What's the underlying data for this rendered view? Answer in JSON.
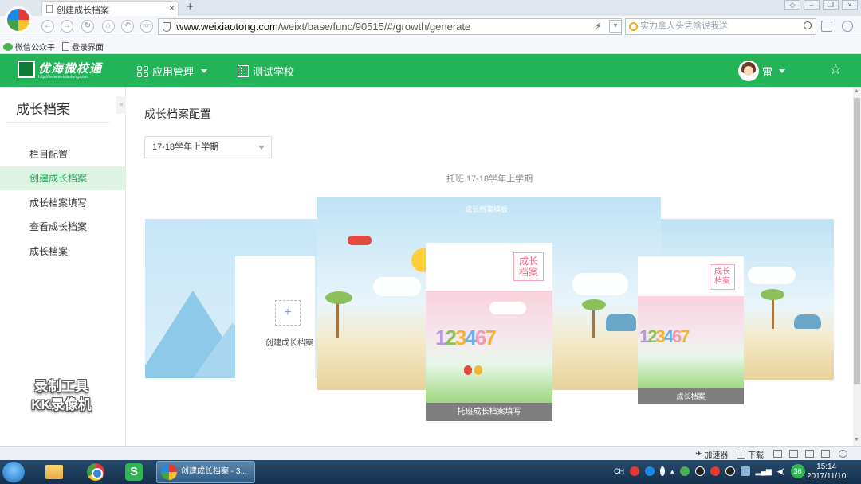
{
  "browser": {
    "tab_title": "创建成长档案",
    "url_domain": "www.weixiaotong.com",
    "url_path": "/weixt/base/func/90515/#/growth/generate",
    "search_placeholder": "实力拿人头凭啥说我送",
    "bookmarks": [
      "微信公众平",
      "登录界面"
    ],
    "new_tab": "+",
    "close": "×"
  },
  "header": {
    "logo_text": "优海微校通",
    "logo_sub": "http://www.weixiaotong.com",
    "menu_app": "应用管理",
    "menu_school": "测试学校",
    "user_name": "雷"
  },
  "sidebar": {
    "title": "成长档案",
    "collapse": "«",
    "items": [
      {
        "label": "栏目配置"
      },
      {
        "label": "创建成长档案"
      },
      {
        "label": "成长档案填写"
      },
      {
        "label": "查看成长档案"
      },
      {
        "label": "成长档案"
      }
    ],
    "active_index": 1,
    "watermark_line1": "录制工具",
    "watermark_line2": "KK录像机"
  },
  "main": {
    "page_title": "成长档案配置",
    "term_select": "17-18学年上学期",
    "section_label": "托班 17-18学年上学期",
    "create_label": "创建成长档案",
    "plus": "+",
    "banner_text": "成长档案模板",
    "stamp": "成长档案",
    "digits": [
      "1",
      "2",
      "3",
      "4",
      "6",
      "7"
    ],
    "cover_center_caption": "托班成长档案填写",
    "cover_right_caption": "成长档案"
  },
  "status": {
    "accelerator": "加速器",
    "download": "下载"
  },
  "taskbar": {
    "active_window": "创建成长档案 - 3...",
    "tray_lang": "CH",
    "tray_badge": "36",
    "time": "15:14",
    "date": "2017/11/10"
  },
  "colors": {
    "brand_green": "#23b45a",
    "active_bg": "#dff3e5",
    "active_text": "#23a655"
  }
}
